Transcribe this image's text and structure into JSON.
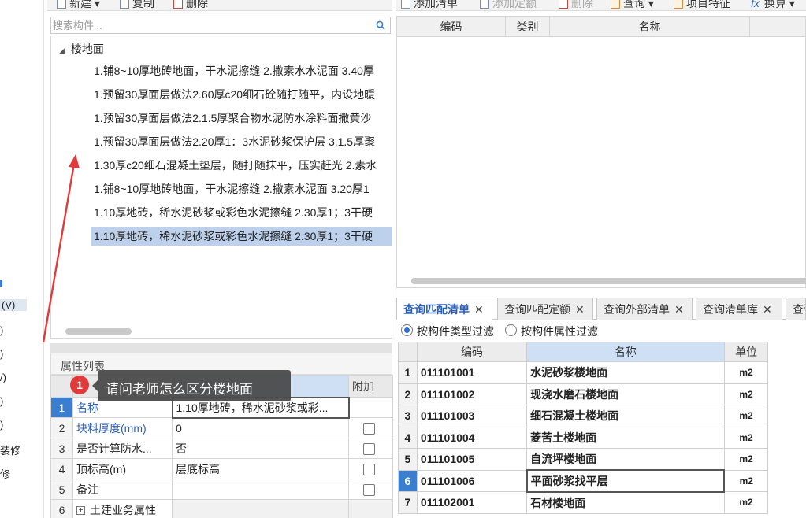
{
  "left_strip": {
    "items": [
      "(V)",
      ")",
      ")",
      "/)",
      ")",
      ")",
      "装修",
      "修"
    ]
  },
  "left_toolbar": {
    "new_label": "新建",
    "copy_label": "复制",
    "delete_label": "删除"
  },
  "search": {
    "placeholder": "搜索构件..."
  },
  "tree": {
    "root_label": "楼地面",
    "items": [
      "1.铺8~10厚地砖地面，干水泥擦缝 2.撒素水水泥面 3.40厚",
      "1.预留30厚面层做法2.60厚c20细石砼随打随平，内设地暖",
      "1.预留30厚面层做法2.1.5厚聚合物水泥防水涂料面撒黄沙",
      "1.预留30厚面层做法2.20厚1：3水泥砂浆保护层 3.1.5厚聚",
      "1.30厚c20细石混凝土垫层，随打随抹平，压实赶光 2.素水",
      "1.铺8~10厚地砖地面，干水泥擦缝 2.撒素水泥面 3.20厚1",
      "1.10厚地砖，稀水泥砂浆或彩色水泥擦缝 2.30厚1；3干硬",
      "1.10厚地砖，稀水泥砂浆或彩色水泥擦缝 2.30厚1；3干硬"
    ]
  },
  "properties": {
    "title": "属性列表",
    "extra_header": "附加",
    "rows": [
      {
        "num": "1",
        "name": "名称",
        "value": "1.10厚地砖，稀水泥砂浆或彩..."
      },
      {
        "num": "2",
        "name": "块料厚度(mm)",
        "value": "0"
      },
      {
        "num": "3",
        "name": "是否计算防水...",
        "value": "否"
      },
      {
        "num": "4",
        "name": "顶标高(m)",
        "value": "层底标高"
      },
      {
        "num": "5",
        "name": "备注",
        "value": ""
      },
      {
        "num": "6",
        "name": "土建业务属性",
        "value": ""
      }
    ]
  },
  "tooltip": {
    "badge": "1",
    "text": "请问老师怎么区分楼地面"
  },
  "right_toolbar": {
    "add_list_label": "添加清单",
    "add_quota_label": "添加定额",
    "delete_label": "删除",
    "query_label": "查询",
    "item_feature_label": "项目特征",
    "convert_label": "换算"
  },
  "top_grid": {
    "columns": [
      "编码",
      "类别",
      "名称"
    ]
  },
  "tabs": [
    "查询匹配清单",
    "查询匹配定额",
    "查询外部清单",
    "查询清单库",
    "查询"
  ],
  "filters": {
    "by_type": "按构件类型过滤",
    "by_attr": "按构件属性过滤"
  },
  "results": {
    "columns": [
      "编码",
      "名称",
      "单位"
    ],
    "rows": [
      {
        "num": "1",
        "code": "011101001",
        "name": "水泥砂浆楼地面",
        "unit": "m2"
      },
      {
        "num": "2",
        "code": "011101002",
        "name": "现浇水磨石楼地面",
        "unit": "m2"
      },
      {
        "num": "3",
        "code": "011101003",
        "name": "细石混凝土楼地面",
        "unit": "m2"
      },
      {
        "num": "4",
        "code": "011101004",
        "name": "菱苦土楼地面",
        "unit": "m2"
      },
      {
        "num": "5",
        "code": "011101005",
        "name": "自流坪楼地面",
        "unit": "m2"
      },
      {
        "num": "6",
        "code": "011101006",
        "name": "平面砂浆找平层",
        "unit": "m2"
      },
      {
        "num": "7",
        "code": "011102001",
        "name": "石材楼地面",
        "unit": "m2"
      }
    ]
  },
  "colors": {
    "selection": "#bdd1ec",
    "active_row": "#3a7fcf",
    "link_blue": "#2b5fb8",
    "annotation_red": "#e23a3a"
  }
}
